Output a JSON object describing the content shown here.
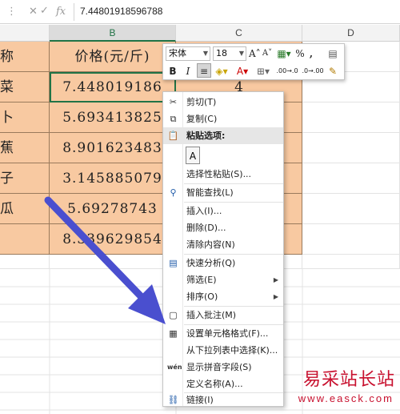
{
  "formula_bar": {
    "cancel_icon": "close-icon",
    "confirm_icon": "check-icon",
    "fx_label": "fx",
    "value": "7.44801918596788"
  },
  "columns": [
    "B",
    "C",
    "D"
  ],
  "rows": [
    {
      "a": "称",
      "b": "价格(元/斤)",
      "c": ""
    },
    {
      "a": "菜",
      "b": "7.448019186",
      "c": "4"
    },
    {
      "a": "卜",
      "b": "5.693413825",
      "c": ""
    },
    {
      "a": "蕉",
      "b": "8.901623483",
      "c": ""
    },
    {
      "a": "子",
      "b": "3.145885079",
      "c": ""
    },
    {
      "a": "瓜",
      "b": "5.69278743",
      "c": ""
    },
    {
      "a": "",
      "b": "8.339629854",
      "c": ""
    }
  ],
  "mini_toolbar": {
    "font_name": "宋体",
    "font_size": "18",
    "grow_font": "A˄",
    "shrink_font": "A˅",
    "percent": "%",
    "comma": ",",
    "bold": "B",
    "italic": "I",
    "increase_decimal": ".00→.0",
    "decrease_decimal": ".0→.00"
  },
  "context_menu": {
    "cut": "剪切(T)",
    "copy": "复制(C)",
    "paste_options": "粘贴选项:",
    "paste_special": "选择性粘贴(S)...",
    "smart_lookup": "智能查找(L)",
    "insert": "插入(I)...",
    "delete": "删除(D)...",
    "clear_contents": "清除内容(N)",
    "quick_analysis": "快速分析(Q)",
    "filter": "筛选(E)",
    "sort": "排序(O)",
    "insert_comment": "插入批注(M)",
    "format_cells": "设置单元格格式(F)...",
    "pick_from_list": "从下拉列表中选择(K)...",
    "show_phonetic": "显示拼音字段(S)",
    "define_name": "定义名称(A)...",
    "link": "链接(I)",
    "phonetic_icon_text": "wén"
  },
  "annotation": {
    "arrow_color": "#4a4fcf"
  },
  "watermark": {
    "title": "易采站长站",
    "url": "www.easck.com"
  },
  "colors": {
    "cell_fill": "#f8c9a1",
    "selection_green": "#217346"
  }
}
